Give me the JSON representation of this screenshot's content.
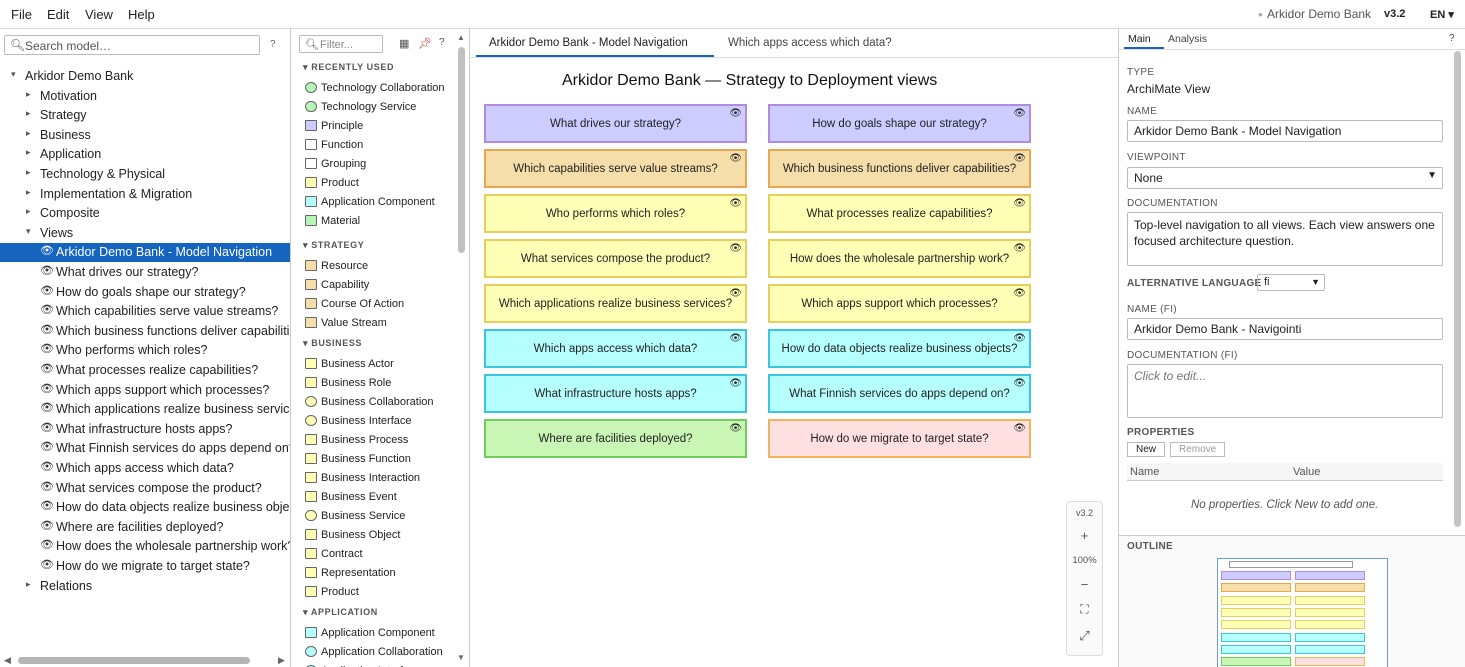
{
  "menu": {
    "file": "File",
    "edit": "Edit",
    "view": "View",
    "help": "Help",
    "project": "Arkidor Demo Bank",
    "version": "v3.2",
    "lang": "EN ▾",
    "project_bullet": "●"
  },
  "tree": {
    "search_placeholder": "Search model…",
    "help": "?",
    "root": "Arkidor Demo Bank",
    "folders": [
      "Motivation",
      "Strategy",
      "Business",
      "Application",
      "Technology & Physical",
      "Implementation & Migration",
      "Composite"
    ],
    "views_folder": "Views",
    "views": [
      "Arkidor Demo Bank - Model Navigation",
      "What drives our strategy?",
      "How do goals shape our strategy?",
      "Which capabilities serve value streams?",
      "Which business functions deliver capabilities?",
      "Who performs which roles?",
      "What processes realize capabilities?",
      "Which apps support which processes?",
      "Which applications realize business services?",
      "What infrastructure hosts apps?",
      "What Finnish services do apps depend on?",
      "Which apps access which data?",
      "What services compose the product?",
      "How do data objects realize business objects?",
      "Where are facilities deployed?",
      "How does the wholesale partnership work?",
      "How do we migrate to target state?"
    ],
    "relations": "Relations"
  },
  "palette": {
    "filter_placeholder": "Filter...",
    "help": "?",
    "recently_used": "RECENTLY USED",
    "recent": [
      "Technology Collaboration",
      "Technology Service",
      "Principle",
      "Function",
      "Grouping",
      "Product",
      "Application Component",
      "Material"
    ],
    "strategy": "STRATEGY",
    "strategy_items": [
      "Resource",
      "Capability",
      "Course Of Action",
      "Value Stream"
    ],
    "business": "BUSINESS",
    "business_items": [
      "Business Actor",
      "Business Role",
      "Business Collaboration",
      "Business Interface",
      "Business Process",
      "Business Function",
      "Business Interaction",
      "Business Event",
      "Business Service",
      "Business Object",
      "Contract",
      "Representation",
      "Product"
    ],
    "application": "APPLICATION",
    "application_items": [
      "Application Component",
      "Application Collaboration",
      "Application Interface"
    ]
  },
  "canvas": {
    "tab_active": "Arkidor Demo Bank - Model Navigation",
    "tab_other": "Which apps access which data?",
    "title": "Arkidor Demo Bank — Strategy to Deployment views",
    "boxes": [
      {
        "label": "What drives our strategy?",
        "fill": "#ccccff",
        "border": "#b28be0"
      },
      {
        "label": "How do goals shape our strategy?",
        "fill": "#ccccff",
        "border": "#b28be0"
      },
      {
        "label": "Which capabilities serve value streams?",
        "fill": "#f5deaa",
        "border": "#e8a852"
      },
      {
        "label": "Which business functions deliver capabilities?",
        "fill": "#f5deaa",
        "border": "#e8a852"
      },
      {
        "label": "Who performs which roles?",
        "fill": "#ffffb5",
        "border": "#e8cf5c"
      },
      {
        "label": "What processes realize capabilities?",
        "fill": "#ffffb5",
        "border": "#e8cf5c"
      },
      {
        "label": "What services compose the product?",
        "fill": "#ffffb5",
        "border": "#e8cf5c"
      },
      {
        "label": "How does the wholesale partnership work?",
        "fill": "#ffffb5",
        "border": "#e8cf5c"
      },
      {
        "label": "Which applications realize business services?",
        "fill": "#ffffb5",
        "border": "#e8cf5c"
      },
      {
        "label": "Which apps support which processes?",
        "fill": "#ffffb5",
        "border": "#e8cf5c"
      },
      {
        "label": "Which apps access which data?",
        "fill": "#b5ffff",
        "border": "#3cc4e0"
      },
      {
        "label": "How do data objects realize business objects?",
        "fill": "#b5ffff",
        "border": "#3cc4e0"
      },
      {
        "label": "What infrastructure hosts apps?",
        "fill": "#b5ffff",
        "border": "#3cc4e0"
      },
      {
        "label": "What Finnish services do apps depend on?",
        "fill": "#b5ffff",
        "border": "#3cc4e0"
      },
      {
        "label": "Where are facilities deployed?",
        "fill": "#c9f5b5",
        "border": "#6fce5a"
      },
      {
        "label": "How do we migrate to target state?",
        "fill": "#ffe0e0",
        "border": "#f0b45a"
      }
    ],
    "zoom": {
      "version": "v3.2",
      "plus": "+",
      "level": "100%",
      "minus": "−"
    }
  },
  "properties": {
    "tab_main": "Main",
    "tab_analysis": "Analysis",
    "help": "?",
    "type_label": "TYPE",
    "type_value": "ArchiMate View",
    "name_label": "NAME",
    "name_value": "Arkidor Demo Bank - Model Navigation",
    "viewpoint_label": "VIEWPOINT",
    "viewpoint_value": "None",
    "doc_label": "DOCUMENTATION",
    "doc_value": "Top-level navigation to all views. Each view answers one focused architecture question.",
    "altlang_label": "ALTERNATIVE LANGUAGE",
    "altlang_value": "fi",
    "namefi_label": "NAME (FI)",
    "namefi_value": "Arkidor Demo Bank - Navigointi",
    "docfi_label": "DOCUMENTATION (FI)",
    "docfi_placeholder": "Click to edit...",
    "properties_label": "PROPERTIES",
    "new_button": "New",
    "remove_button": "Remove",
    "col_name": "Name",
    "col_value": "Value",
    "empty": "No properties. Click New to add one.",
    "outline_label": "OUTLINE"
  }
}
